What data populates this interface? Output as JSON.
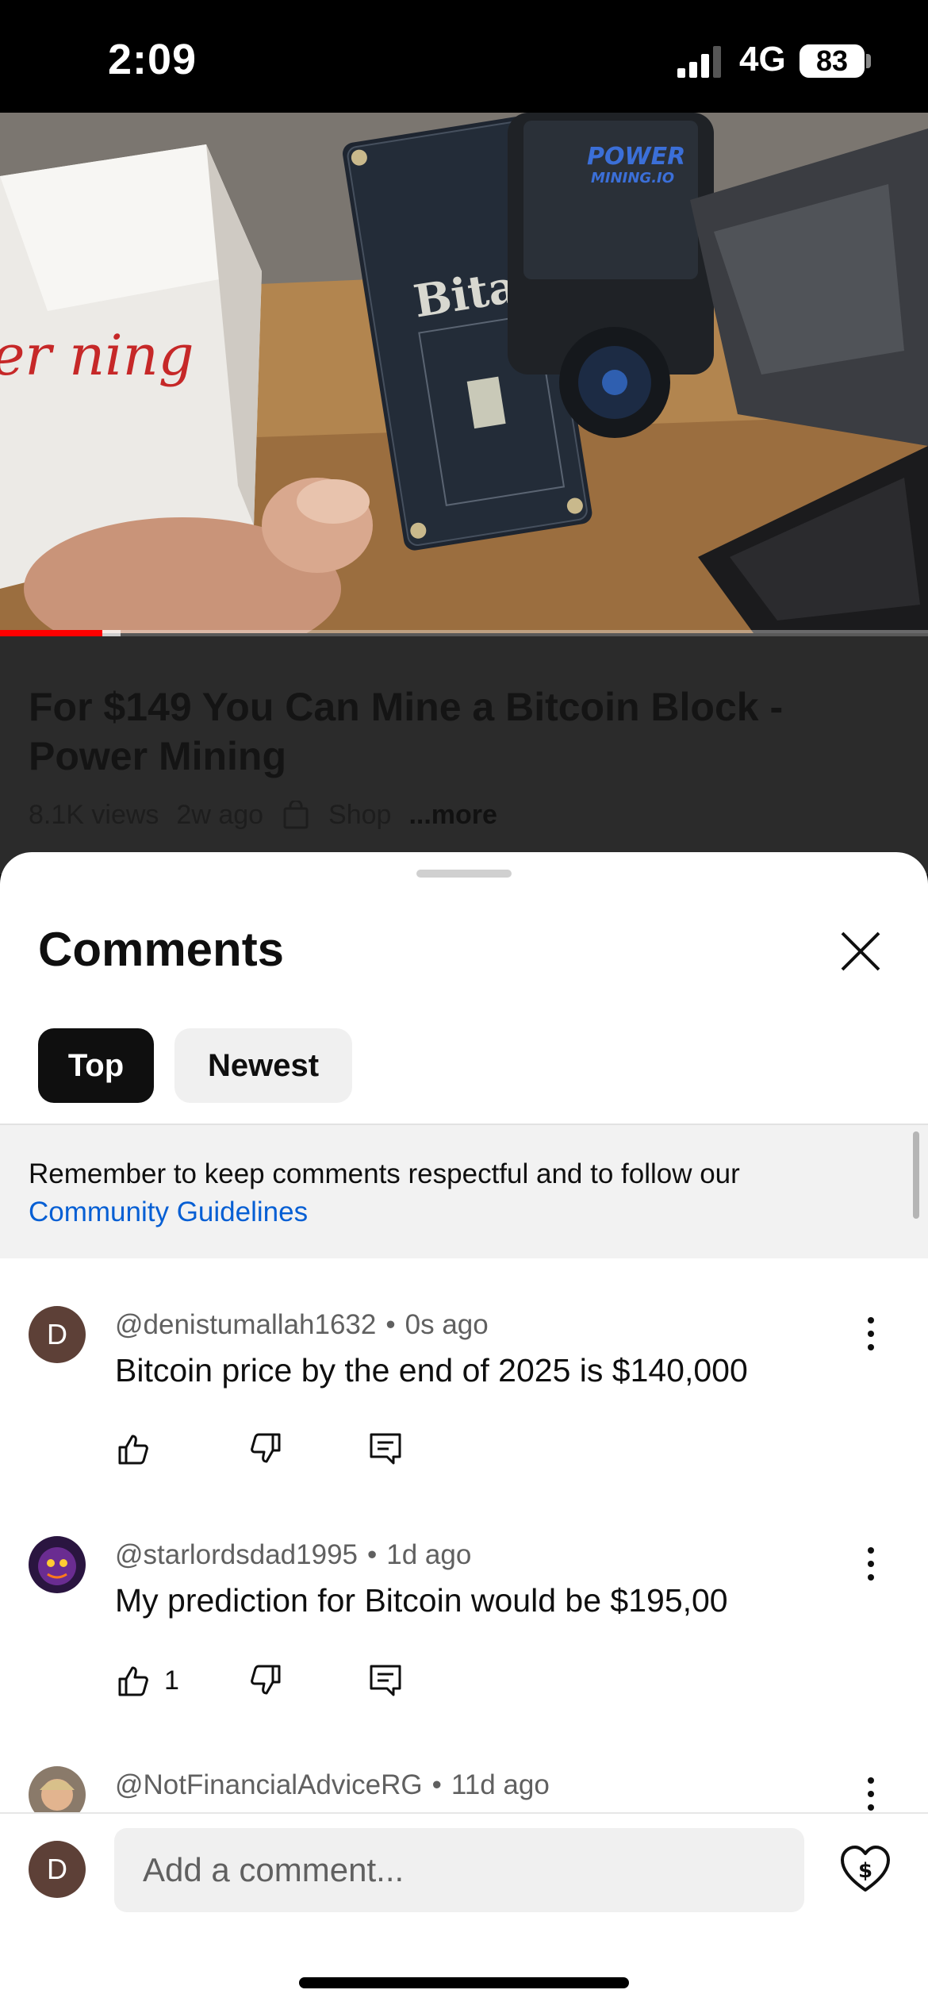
{
  "status_bar": {
    "time": "2:09",
    "network": "4G",
    "battery": "83"
  },
  "video": {
    "title": "For $149 You Can Mine a Bitcoin Block - Power Mining",
    "views": "8.1K views",
    "age": "2w ago",
    "shop_label": "Shop",
    "more_label": "...more",
    "progress_percent": 11,
    "buffered_percent": 13,
    "thumbnail_text": {
      "board_brand": "Bitaxe",
      "device_brand_line1": "POWER",
      "device_brand_line2": "MINING.IO",
      "box_scribble": "er ning"
    }
  },
  "comments_panel": {
    "title": "Comments",
    "tabs": [
      {
        "label": "Top",
        "selected": true
      },
      {
        "label": "Newest",
        "selected": false
      }
    ],
    "guidelines_text": "Remember to keep comments respectful and to follow our",
    "guidelines_link": "Community Guidelines",
    "comments": [
      {
        "author": "@denistumallah1632",
        "separator": "•",
        "age": "0s ago",
        "text": "Bitcoin price by the end of 2025 is $140,000",
        "like_count": "",
        "avatar_letter": "D",
        "avatar_color": "#5d4037"
      },
      {
        "author": "@starlordsdad1995",
        "separator": "•",
        "age": "1d ago",
        "text": "My prediction for Bitcoin would be $195,00",
        "like_count": "1",
        "avatar_letter": "",
        "avatar_color": "#3b1f5c"
      },
      {
        "author": "@NotFinancialAdviceRG",
        "separator": "•",
        "age": "11d ago",
        "text": "",
        "like_count": "",
        "avatar_letter": "",
        "avatar_color": "#c8a27a"
      }
    ]
  },
  "composer": {
    "avatar_letter": "D",
    "placeholder": "Add a comment..."
  },
  "colors": {
    "accent_red": "#ff0000",
    "link_blue": "#065fd4",
    "chip_selected_bg": "#0f0f0f",
    "chip_bg": "#f0f0f0"
  },
  "icons": [
    "signal-icon",
    "shopping-bag-icon",
    "close-icon",
    "more-vert-icon",
    "like-icon",
    "dislike-icon",
    "reply-icon",
    "super-thanks-icon"
  ]
}
